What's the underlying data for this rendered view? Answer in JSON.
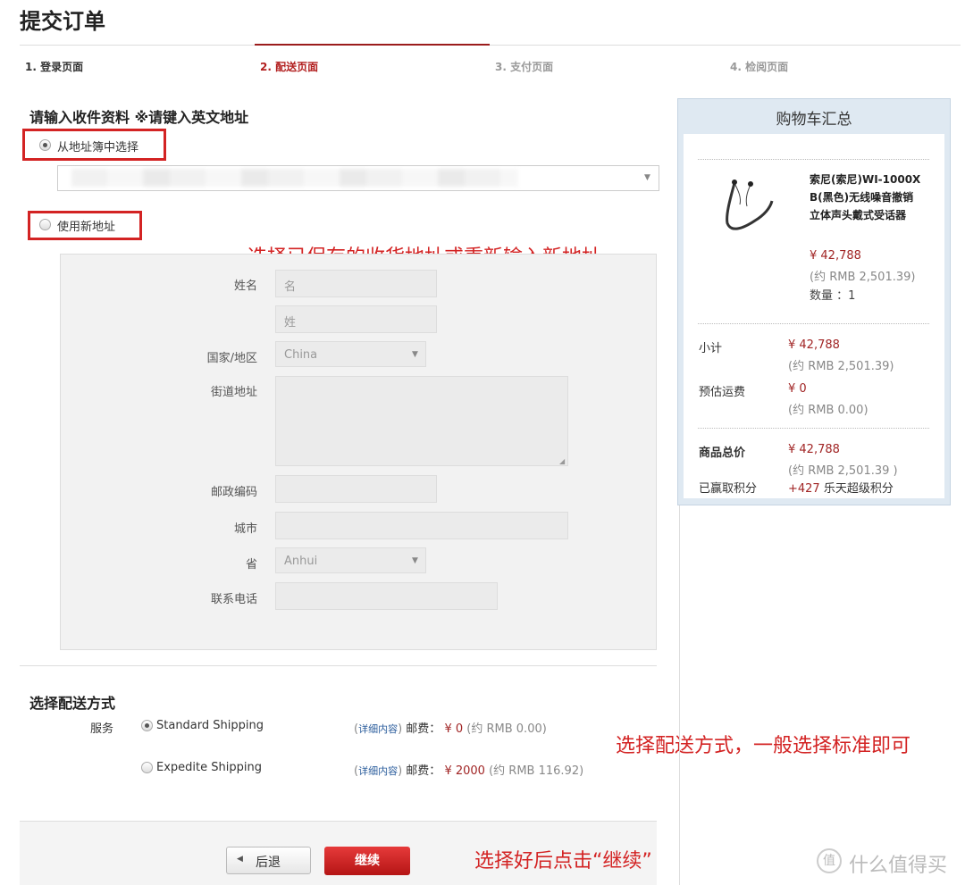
{
  "page_title": "提交订单",
  "steps": [
    "1. 登录页面",
    "2. 配送页面",
    "3. 支付页面",
    "4. 检阅页面"
  ],
  "address": {
    "heading": "请输入收件资料 ※请键入英文地址",
    "option_book": "从地址簿中选择",
    "option_new": "使用新地址"
  },
  "form": {
    "name_label": "姓名",
    "first_placeholder": "名",
    "last_placeholder": "姓",
    "country_label": "国家/地区",
    "country_value": "China",
    "street_label": "街道地址",
    "zip_label": "邮政编码",
    "city_label": "城市",
    "province_label": "省",
    "province_value": "Anhui",
    "phone_label": "联系电话"
  },
  "annotations": {
    "address_note": "选择已保存的收货地址或重新输入新地址",
    "shipping_note": "选择配送方式，一般选择标准即可",
    "continue_note": "选择好后点击“继续”"
  },
  "cart": {
    "title": "购物车汇总",
    "product_name": "索尼(索尼)WI-1000XB(黑色)无线噪音撤销立体声头戴式受话器",
    "product_name_lines": [
      "索尼(索尼)WI-1000X",
      "B(黑色)无线噪音撤销",
      "立体声头戴式受话器"
    ],
    "price": "¥ 42,788",
    "price_rmb": "(约 RMB 2,501.39)",
    "qty": "数量 ：1",
    "subtotal_label": "小计",
    "subtotal": "¥ 42,788",
    "subtotal_rmb": "(约 RMB 2,501.39)",
    "shipping_label": "预估运费",
    "shipping": "¥ 0",
    "shipping_rmb": "(约 RMB 0.00)",
    "total_label": "商品总价",
    "total": "¥ 42,788",
    "total_rmb": "(约 RMB 2,501.39 )",
    "points_label": "已赢取积分",
    "points": "+427",
    "points_suffix": "乐天超级积分"
  },
  "shipping": {
    "heading": "选择配送方式",
    "service_label": "服务",
    "options": [
      {
        "name": "Standard Shipping",
        "details": "详细内容",
        "fee_label": "邮费：",
        "fee": "¥ 0",
        "fee_rmb": "(约 RMB 0.00)"
      },
      {
        "name": "Expedite Shipping",
        "details": "详细内容",
        "fee_label": "邮费：",
        "fee": "¥ 2000",
        "fee_rmb": "(约 RMB 116.92)"
      }
    ]
  },
  "buttons": {
    "back": "后退",
    "continue": "继续"
  },
  "watermark": "什么值得买",
  "colors": {
    "accent": "#b21f1f",
    "annotation": "#d32323",
    "sidebar": "#dfe9f2"
  }
}
